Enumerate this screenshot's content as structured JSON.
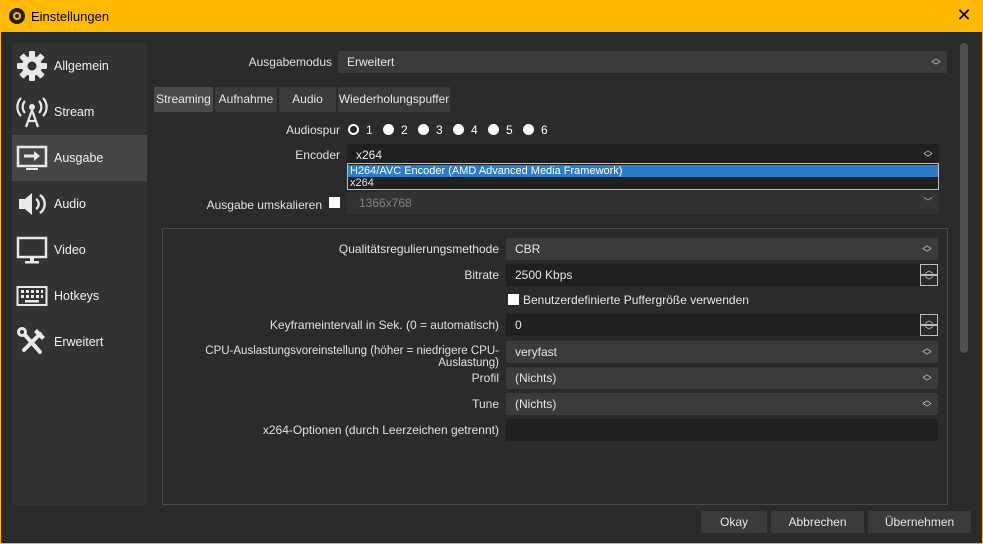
{
  "window": {
    "title": "Einstellungen",
    "close_glyph": "✕"
  },
  "sidebar": {
    "items": [
      {
        "label": "Allgemein",
        "icon": "gear-icon"
      },
      {
        "label": "Stream",
        "icon": "antenna-icon"
      },
      {
        "label": "Ausgabe",
        "icon": "output-icon",
        "active": true
      },
      {
        "label": "Audio",
        "icon": "speaker-icon"
      },
      {
        "label": "Video",
        "icon": "monitor-icon"
      },
      {
        "label": "Hotkeys",
        "icon": "keyboard-icon"
      },
      {
        "label": "Erweitert",
        "icon": "tools-icon"
      }
    ]
  },
  "output": {
    "mode_label": "Ausgabemodus",
    "mode_value": "Erweitert",
    "tabs": [
      "Streaming",
      "Aufnahme",
      "Audio",
      "Wiederholungspuffer"
    ],
    "active_tab": "Streaming",
    "audiotrack_label": "Audiospur",
    "audiotracks": [
      "1",
      "2",
      "3",
      "4",
      "5",
      "6"
    ],
    "audiotrack_selected": "1",
    "encoder_label": "Encoder",
    "encoder_value": "x264",
    "encoder_options": [
      "H264/AVC Encoder (AMD Advanced Media Framework)",
      "x264"
    ],
    "rescale_label": "Ausgabe umskalieren",
    "rescale_value": "1366x768"
  },
  "encoder_settings": {
    "rate_control_label": "Qualitätsregulierungsmethode",
    "rate_control_value": "CBR",
    "bitrate_label": "Bitrate",
    "bitrate_value": "2500 Kbps",
    "custom_buffer_label": "Benutzerdefinierte Puffergröße verwenden",
    "keyframe_label": "Keyframeintervall in Sek. (0 = automatisch)",
    "keyframe_value": "0",
    "cpu_preset_label": "CPU-Auslastungsvoreinstellung (höher = niedrigere CPU-Auslastung)",
    "cpu_preset_value": "veryfast",
    "profile_label": "Profil",
    "profile_value": "(Nichts)",
    "tune_label": "Tune",
    "tune_value": "(Nichts)",
    "x264_options_label": "x264-Optionen (durch Leerzeichen getrennt)",
    "x264_options_value": ""
  },
  "buttons": {
    "ok": "Okay",
    "cancel": "Abbrechen",
    "apply": "Übernehmen"
  },
  "colors": {
    "accent": "#ffb900",
    "selection": "#2d7cc9"
  }
}
